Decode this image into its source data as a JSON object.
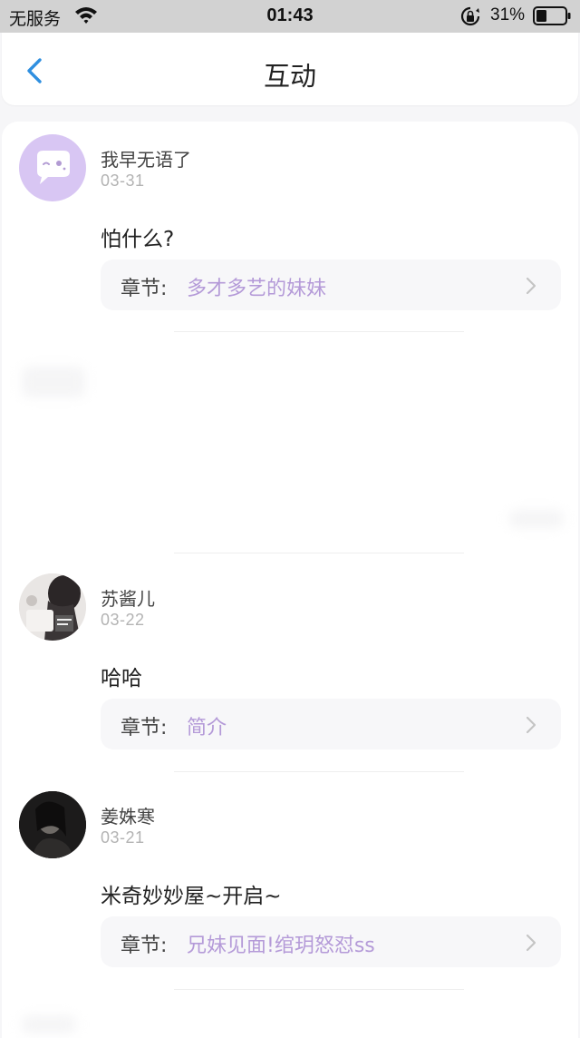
{
  "status_bar": {
    "carrier": "无服务",
    "time": "01:43",
    "battery": "31%"
  },
  "nav": {
    "title": "互动"
  },
  "comments": [
    {
      "username": "我早无语了",
      "date": "03-31",
      "text": "怕什么?",
      "chapter_label": "章节:",
      "chapter_title": "多才多艺的妹妹"
    },
    {
      "username": "苏酱儿",
      "date": "03-22",
      "text": "哈哈",
      "chapter_label": "章节:",
      "chapter_title": "简介"
    },
    {
      "username": "姜姝寒",
      "date": "03-21",
      "text": "米奇妙妙屋~开启~",
      "chapter_label": "章节:",
      "chapter_title": "兄妹见面!绾玥怒怼ss"
    }
  ],
  "colors": {
    "accent": "#b49ad8",
    "back_arrow": "#2f8fe0",
    "avatar_default": "#d8c6f3"
  }
}
